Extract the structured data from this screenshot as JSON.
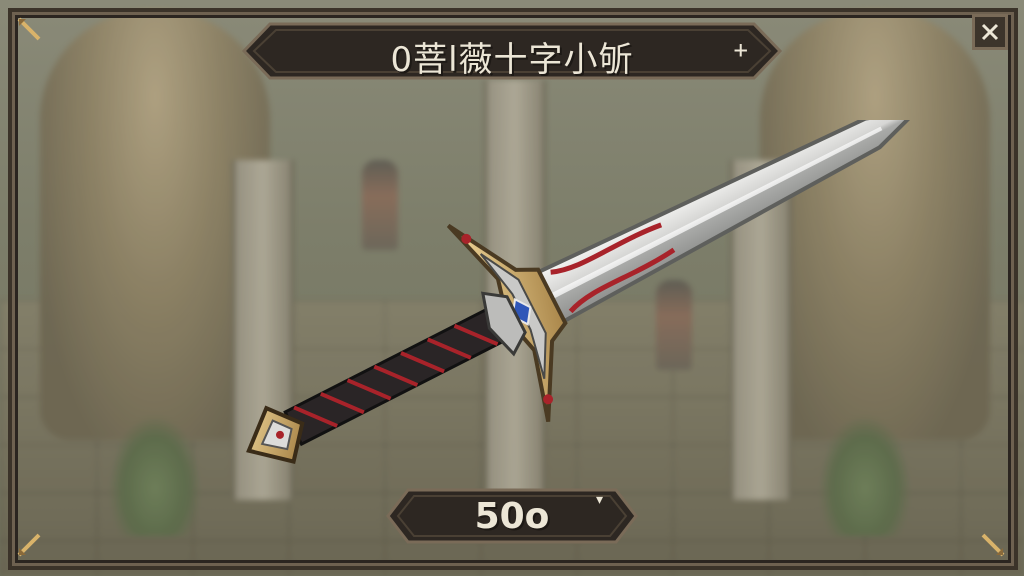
{
  "panel": {
    "title": "0菩l薇十字小斪",
    "title_plus": "+",
    "price": "50o",
    "price_marker": "▾"
  },
  "item": {
    "icon": "sword-icon"
  },
  "controls": {
    "close_icon": "close-icon"
  },
  "colors": {
    "frame_dark": "#3b3329",
    "frame_light": "#6e6150",
    "banner_fill": "#2d2722",
    "text": "#ece6d6",
    "gold": "#d9b36a",
    "blade": "#d8d8d6",
    "grip_red": "#a8232a",
    "gem_blue": "#2f56b8"
  }
}
